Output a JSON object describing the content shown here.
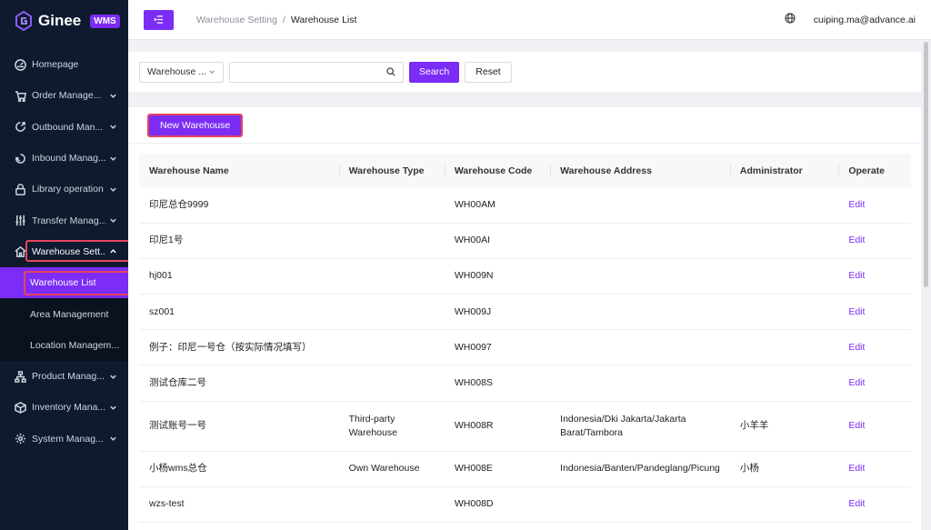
{
  "brand": {
    "name": "Ginee",
    "badge": "WMS"
  },
  "sidebar": {
    "items": [
      {
        "label": "Homepage",
        "icon": "dashboard-icon",
        "chevron": false
      },
      {
        "label": "Order Manage...",
        "icon": "cart-icon",
        "chevron": true
      },
      {
        "label": "Outbound Man...",
        "icon": "outbound-icon",
        "chevron": true
      },
      {
        "label": "Inbound Manag...",
        "icon": "inbound-icon",
        "chevron": true
      },
      {
        "label": "Library operation",
        "icon": "lock-icon",
        "chevron": true
      },
      {
        "label": "Transfer Manag...",
        "icon": "sliders-icon",
        "chevron": true
      },
      {
        "label": "Warehouse Sett...",
        "icon": "warehouse-icon",
        "chevron": true
      },
      {
        "label": "Product Manag...",
        "icon": "hierarchy-icon",
        "chevron": true
      },
      {
        "label": "Inventory Mana...",
        "icon": "box-icon",
        "chevron": true
      },
      {
        "label": "System Manag...",
        "icon": "gear-icon",
        "chevron": true
      }
    ],
    "subitems": [
      {
        "label": "Warehouse List"
      },
      {
        "label": "Area Management"
      },
      {
        "label": "Location Managem..."
      }
    ]
  },
  "header": {
    "breadcrumb_parent": "Warehouse Setting",
    "breadcrumb_sep": "/",
    "breadcrumb_current": "Warehouse List",
    "user_email": "cuiping.ma@advance.ai"
  },
  "filter": {
    "select_value": "Warehouse ...",
    "search_placeholder": "",
    "search_label": "Search",
    "reset_label": "Reset"
  },
  "toolbar": {
    "new_label": "New Warehouse"
  },
  "table": {
    "columns": [
      "Warehouse Name",
      "Warehouse Type",
      "Warehouse Code",
      "Warehouse Address",
      "Administrator",
      "Operate"
    ],
    "rows": [
      {
        "name": "印尼总仓9999",
        "type": "",
        "code": "WH00AM",
        "address": "",
        "admin": "",
        "op": "Edit"
      },
      {
        "name": "印尼1号",
        "type": "",
        "code": "WH00AI",
        "address": "",
        "admin": "",
        "op": "Edit"
      },
      {
        "name": "hj001",
        "type": "",
        "code": "WH009N",
        "address": "",
        "admin": "",
        "op": "Edit"
      },
      {
        "name": "sz001",
        "type": "",
        "code": "WH009J",
        "address": "",
        "admin": "",
        "op": "Edit"
      },
      {
        "name": "例子：印尼一号仓（按实际情况填写）",
        "type": "",
        "code": "WH0097",
        "address": "",
        "admin": "",
        "op": "Edit"
      },
      {
        "name": "测试仓库二号",
        "type": "",
        "code": "WH008S",
        "address": "",
        "admin": "",
        "op": "Edit"
      },
      {
        "name": "测试账号一号",
        "type": "Third-party Warehouse",
        "code": "WH008R",
        "address": "Indonesia/Dki Jakarta/Jakarta Barat/Tambora",
        "admin": "小羊羊",
        "op": "Edit"
      },
      {
        "name": "小杨wms总仓",
        "type": "Own Warehouse",
        "code": "WH008E",
        "address": "Indonesia/Banten/Pandeglang/Picung",
        "admin": "小杨",
        "op": "Edit"
      },
      {
        "name": "wzs-test",
        "type": "",
        "code": "WH008D",
        "address": "",
        "admin": "",
        "op": "Edit"
      }
    ]
  },
  "colors": {
    "accent": "#7b2cf5",
    "sidebar_bg": "#0f1a2e",
    "highlight": "#e5455e"
  }
}
